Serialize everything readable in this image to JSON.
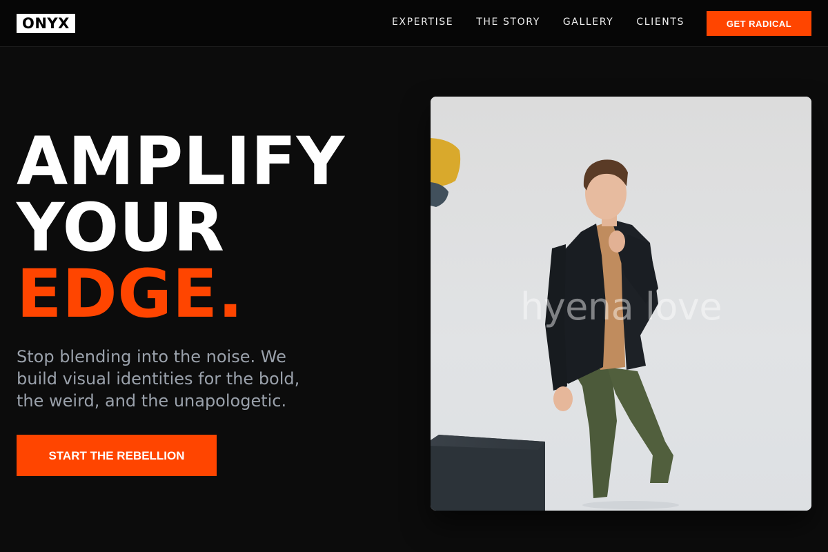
{
  "brand": {
    "logo_text": "ONYX"
  },
  "nav": {
    "links": [
      "EXPERTISE",
      "THE STORY",
      "GALLERY",
      "CLIENTS"
    ],
    "cta_label": "GET RADICAL"
  },
  "hero": {
    "title_line1": "AMPLIFY",
    "title_line2": "YOUR",
    "title_line3": "EDGE.",
    "subtitle": "Stop blending into the noise. We build visual identities for the bold, the weird, and the unapologetic.",
    "cta_label": "START THE REBELLION",
    "image_watermark": "hyena love"
  },
  "colors": {
    "accent": "#ff4500",
    "background": "#0c0c0c",
    "navbar": "#060606",
    "text_primary": "#ffffff",
    "text_muted": "#9aa1ab"
  }
}
